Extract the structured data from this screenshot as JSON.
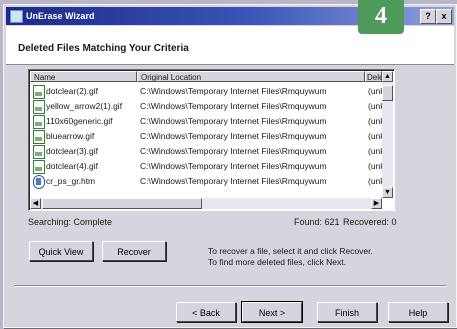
{
  "window": {
    "title": "UnErase Wizard",
    "help_button": "?",
    "close_button": "x"
  },
  "badge": {
    "number": "4"
  },
  "header": {
    "title": "Deleted Files Matching Your Criteria"
  },
  "list": {
    "columns": [
      "Name",
      "Original Location",
      "Delet"
    ],
    "rows": [
      {
        "name": "dotclear(2).gif",
        "location": "C:\\Windows\\Temporary Internet Files\\Rmquywum",
        "deleted": "(unkr",
        "icon": "gif-file-icon"
      },
      {
        "name": "yellow_arrow2(1).gif",
        "location": "C:\\Windows\\Temporary Internet Files\\Rmquywum",
        "deleted": "(unkr",
        "icon": "gif-file-icon"
      },
      {
        "name": "110x60generic.gif",
        "location": "C:\\Windows\\Temporary Internet Files\\Rmquywum",
        "deleted": "(unkr",
        "icon": "gif-file-icon"
      },
      {
        "name": "bluearrow.gif",
        "location": "C:\\Windows\\Temporary Internet Files\\Rmquywum",
        "deleted": "(unkr",
        "icon": "gif-file-icon"
      },
      {
        "name": "dotclear(3).gif",
        "location": "C:\\Windows\\Temporary Internet Files\\Rmquywum",
        "deleted": "(unkr",
        "icon": "gif-file-icon"
      },
      {
        "name": "dotclear(4).gif",
        "location": "C:\\Windows\\Temporary Internet Files\\Rmquywum",
        "deleted": "(unkr",
        "icon": "gif-file-icon"
      },
      {
        "name": "cr_ps_gr.htm",
        "location": "C:\\Windows\\Temporary Internet Files\\Rmquywum",
        "deleted": "(unkr",
        "icon": "htm-file-icon"
      }
    ]
  },
  "status": {
    "searching": "Searching:  Complete",
    "found": "Found: 621",
    "recovered": "Recovered:  0"
  },
  "actions": {
    "quick_view": "Quick View",
    "recover": "Recover"
  },
  "hint": {
    "line1": "To recover a file, select it and click Recover.",
    "line2": "To find more deleted files, click Next."
  },
  "nav": {
    "back": "< Back",
    "next": "Next >",
    "finish": "Finish",
    "help": "Help"
  }
}
